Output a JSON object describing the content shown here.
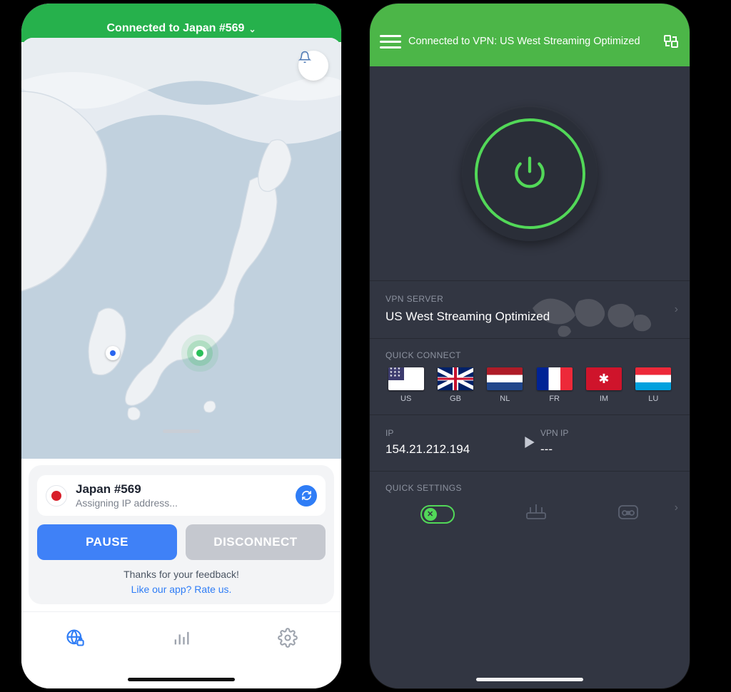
{
  "left": {
    "header": {
      "status": "Connected to Japan #569"
    },
    "server": {
      "name": "Japan #569",
      "status": "Assigning IP address..."
    },
    "buttons": {
      "pause": "PAUSE",
      "disconnect": "DISCONNECT"
    },
    "feedback": {
      "line1": "Thanks for your feedback!",
      "line2": "Like our app? Rate us."
    }
  },
  "right": {
    "header": {
      "status": "Connected to VPN: US West Streaming Optimized"
    },
    "server_section": {
      "label": "VPN SERVER",
      "name": "US West Streaming Optimized"
    },
    "quick_connect": {
      "label": "QUICK CONNECT",
      "items": [
        {
          "code": "US",
          "flag": "us"
        },
        {
          "code": "GB",
          "flag": "gb"
        },
        {
          "code": "NL",
          "flag": "nl"
        },
        {
          "code": "FR",
          "flag": "fr"
        },
        {
          "code": "IM",
          "flag": "im"
        },
        {
          "code": "LU",
          "flag": "lu"
        }
      ]
    },
    "ip": {
      "label_ip": "IP",
      "value_ip": "154.21.212.194",
      "label_vpn": "VPN IP",
      "value_vpn": "---"
    },
    "quick_settings": {
      "label": "QUICK SETTINGS"
    }
  }
}
